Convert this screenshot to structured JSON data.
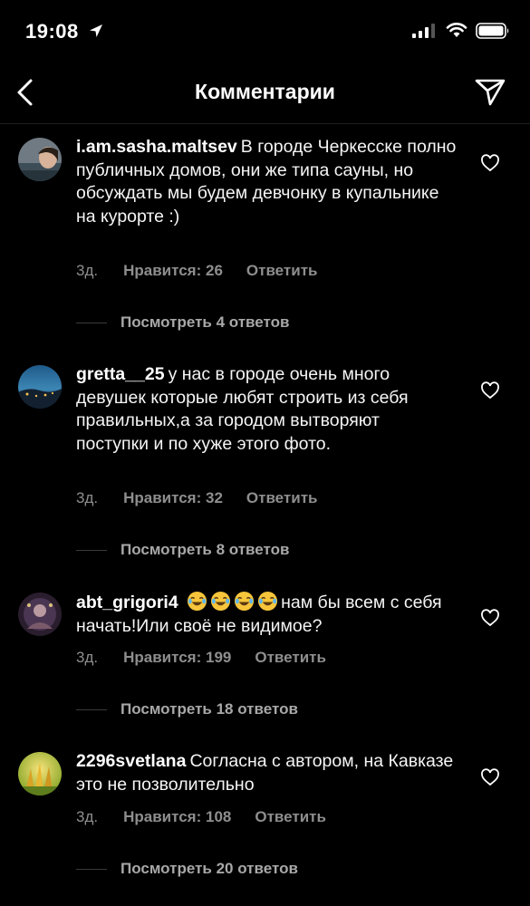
{
  "status_bar": {
    "time": "19:08"
  },
  "header": {
    "title": "Комментарии"
  },
  "comments": [
    {
      "username": "i.am.sasha.maltsev",
      "text": "В городе Черкесске полно публичных домов, они же типа сауны, но обсуждать мы будем девчонку в купальнике на курорте :)",
      "time": "3д.",
      "likes": "Нравится: 26",
      "reply": "Ответить",
      "view_replies": "Посмотреть 4 ответов"
    },
    {
      "username": "gretta__25",
      "text": "у нас в городе очень много девушек которые любят строить из себя правильных,а за городом вытворяют поступки и по хуже этого фото.",
      "time": "3д.",
      "likes": "Нравится: 32",
      "reply": "Ответить",
      "view_replies": "Посмотреть 8 ответов"
    },
    {
      "username": "abt_grigori4",
      "emoji": "😂😂😂😂",
      "text": "нам бы всем с себя начать!Или своё не видимое?",
      "time": "3д.",
      "likes": "Нравится: 199",
      "reply": "Ответить",
      "view_replies": "Посмотреть 18 ответов"
    },
    {
      "username": "2296svetlana",
      "text": "Согласна с автором, на Кавказе это не позволительно",
      "time": "3д.",
      "likes": "Нравится: 108",
      "reply": "Ответить",
      "view_replies": "Посмотреть 20 ответов"
    }
  ]
}
